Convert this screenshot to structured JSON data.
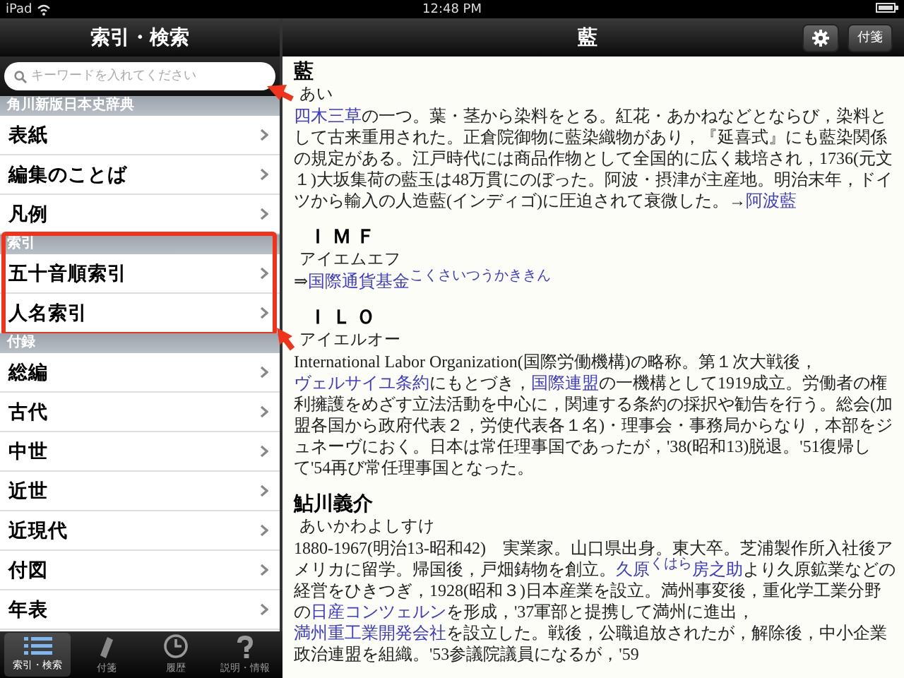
{
  "status_bar": {
    "device": "iPad",
    "time": "12:48 PM"
  },
  "sidebar": {
    "title": "索引・検索",
    "search": {
      "placeholder": "キーワードを入れてください"
    },
    "sections": [
      {
        "header": "角川新版日本史辞典",
        "highlighted": false,
        "items": [
          {
            "label": "表紙"
          },
          {
            "label": "編集のことば"
          },
          {
            "label": "凡例"
          }
        ]
      },
      {
        "header": "索引",
        "highlighted": true,
        "items": [
          {
            "label": "五十音順索引"
          },
          {
            "label": "人名索引"
          }
        ]
      },
      {
        "header": "付録",
        "highlighted": false,
        "items": [
          {
            "label": "総編"
          },
          {
            "label": "古代"
          },
          {
            "label": "中世"
          },
          {
            "label": "近世"
          },
          {
            "label": "近現代"
          },
          {
            "label": "付図"
          },
          {
            "label": "年表"
          }
        ]
      }
    ]
  },
  "tab_bar": [
    {
      "label": "索引・検索",
      "kind": "list",
      "selected": true
    },
    {
      "label": "付箋",
      "kind": "tag",
      "selected": false
    },
    {
      "label": "履歴",
      "kind": "clock",
      "selected": false
    },
    {
      "label": "説明・情報",
      "kind": "question",
      "selected": false
    }
  ],
  "reader": {
    "title": "藍",
    "buttons": [
      {
        "kind": "gear"
      },
      {
        "kind": "text",
        "label": "付箋"
      }
    ],
    "entries": [
      {
        "headword": "藍",
        "reading": "あい",
        "latin": false,
        "body": [
          {
            "kind": "link",
            "text": "四木三草"
          },
          {
            "kind": "text",
            "text": "の一つ。葉・茎から染料をとる。紅花・あかねなどとならび，染料として古来重用された。正倉院御物に藍染織物があり，『延喜式』にも藍染関係の規定がある。江戸時代には商品作物として全国的に広く栽培され，1736(元文１)大坂集荷の藍玉は48万貫にのぼった。阿波・摂津が主産地。明治末年，ドイツから輸入の人造藍(インディゴ)に圧迫されて衰微した。→"
          },
          {
            "kind": "link",
            "text": "阿波藍"
          }
        ]
      },
      {
        "headword": "ＩＭＦ",
        "reading": "アイエムエフ",
        "latin": true,
        "body": [
          {
            "kind": "text",
            "text": "⇒"
          },
          {
            "kind": "link",
            "text": "国際通貨基金"
          },
          {
            "kind": "ruby",
            "text": "こくさいつうかききん"
          }
        ]
      },
      {
        "headword": "ＩＬＯ",
        "reading": "アイエルオー",
        "latin": true,
        "body": [
          {
            "kind": "text",
            "text": "International Labor Organization(国際労働機構)の略称。第１次大戦後，"
          },
          {
            "kind": "link",
            "text": "ヴェルサイユ条約"
          },
          {
            "kind": "text",
            "text": "にもとづき，"
          },
          {
            "kind": "link",
            "text": "国際連盟"
          },
          {
            "kind": "text",
            "text": "の一機構として1919成立。労働者の権利擁護をめざす立法活動を中心に，関連する条約の採択や勧告を行う。総会(加盟各国から政府代表２，労使代表各１名)・理事会・事務局からなり，本部をジュネーヴにおく。日本は常任理事国であったが，'38(昭和13)脱退。'51復帰して'54再び常任理事国となった。"
          }
        ]
      },
      {
        "headword": "鮎川義介",
        "reading": "あいかわよしすけ",
        "latin": false,
        "body": [
          {
            "kind": "text",
            "text": "1880-1967(明治13-昭和42)　実業家。山口県出身。東大卒。芝浦製作所入社後アメリカに留学。帰国後，戸畑鋳物を創立。"
          },
          {
            "kind": "link",
            "text": "久原"
          },
          {
            "kind": "ruby",
            "text": "くはら"
          },
          {
            "kind": "link",
            "text": "房之助"
          },
          {
            "kind": "text",
            "text": "より久原鉱業などの経営をひきつぎ，1928(昭和３)日本産業を設立。満州事変後，重化学工業分野の"
          },
          {
            "kind": "link",
            "text": "日産コンツェルン"
          },
          {
            "kind": "text",
            "text": "を形成，'37軍部と提携して満州に進出，"
          },
          {
            "kind": "link",
            "text": "満州重工業開発会社"
          },
          {
            "kind": "text",
            "text": "を設立した。戦後，公職追放されたが，解除後，中小企業政治連盟を組織。'53参議院議員になるが，'59"
          }
        ]
      }
    ]
  }
}
